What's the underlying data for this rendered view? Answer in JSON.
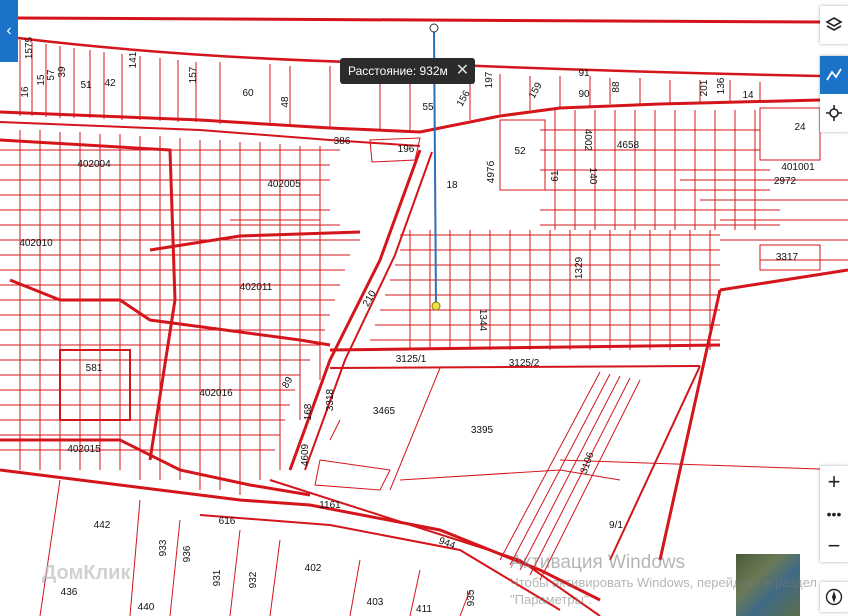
{
  "measurement": {
    "text": "Расстояние: 932м",
    "close_icon": "close-icon"
  },
  "parcels": [
    "1575",
    "16",
    "15",
    "57",
    "39",
    "51",
    "42",
    "141",
    "157",
    "60",
    "48",
    "55",
    "156",
    "197",
    "159",
    "91",
    "90",
    "88",
    "201",
    "136",
    "14",
    "24",
    "386",
    "196",
    "4002",
    "4658",
    "52",
    "497б",
    "18",
    "61",
    "140",
    "401001",
    "2972",
    "402004",
    "402005",
    "402010",
    "402011",
    "210",
    "1329",
    "3317",
    "1344",
    "581",
    "3125/1",
    "3125/2",
    "402016",
    "89",
    "168",
    "3318",
    "3465",
    "3395",
    "402015",
    "4609",
    "3106",
    "1161",
    "9/1",
    "442",
    "616",
    "944",
    "933",
    "936",
    "931",
    "932",
    "402",
    "436",
    "440",
    "403",
    "411",
    "935"
  ],
  "watermark": {
    "title": "Активация Windows",
    "body": "Чтобы активировать Windows, перейдите в раздел \"Параметры\"."
  },
  "logo_text": "ДомКлик",
  "icons": {
    "left_tab": "chevron-left-icon",
    "layers": "layers-icon",
    "ruler": "ruler-icon",
    "locate": "crosshair-icon",
    "zoom_in": "plus-icon",
    "more": "more-icon",
    "zoom_out": "minus-icon",
    "compass": "compass-icon"
  },
  "colors": {
    "parcel_line": "#d4151b",
    "accent": "#1a73c8",
    "measure_line": "#2b6fb7"
  }
}
